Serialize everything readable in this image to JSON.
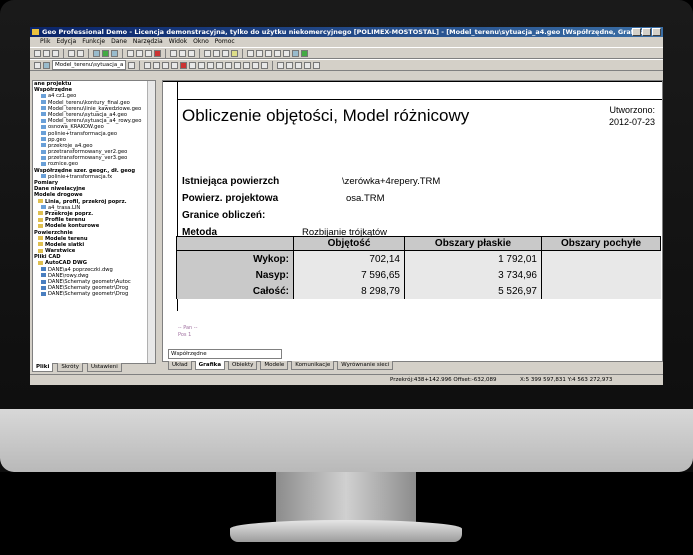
{
  "window": {
    "title": "Geo Professional Demo - Licencja demonstracyjna, tylko do użytku niekomercyjnego [POLIMEX-MOSTOSTAL] - [Model_terenu\\sytuacja_a4.geo [Współrzędne, Grafika]]"
  },
  "menu": [
    "Plik",
    "Edycja",
    "Funkcje",
    "Dane",
    "Narzędzia",
    "Widok",
    "Okno",
    "Pomoc"
  ],
  "toolbar": {
    "combo": "Model_terenu\\sytuacja_a"
  },
  "sidebar": {
    "items": [
      {
        "label": "ane projektu",
        "bold": true,
        "icon": ""
      },
      {
        "label": "Współrzędne",
        "bold": true,
        "icon": ""
      },
      {
        "label": "a4 cz1.geo",
        "bold": false,
        "icon": "geo"
      },
      {
        "label": "Model_terenu\\kontury_final.geo",
        "bold": false,
        "icon": "geo"
      },
      {
        "label": "Model_terenu\\linie_kawedziowe.geo",
        "bold": false,
        "icon": "geo"
      },
      {
        "label": "Model_terenu\\sytuacja_a4.geo",
        "bold": false,
        "icon": "geo"
      },
      {
        "label": "Model_terenu\\sytuacja_a4_rowy.geo",
        "bold": false,
        "icon": "geo"
      },
      {
        "label": "osnowa_KRAKOW.geo",
        "bold": false,
        "icon": "geo"
      },
      {
        "label": "polinie+transformacja.geo",
        "bold": false,
        "icon": "geo"
      },
      {
        "label": "pp.geo",
        "bold": false,
        "icon": "geo"
      },
      {
        "label": "przekroje_a4.geo",
        "bold": false,
        "icon": "geo"
      },
      {
        "label": "przetransformowany_ver2.geo",
        "bold": false,
        "icon": "geo"
      },
      {
        "label": "przetransformowany_ver3.geo",
        "bold": false,
        "icon": "geo"
      },
      {
        "label": "roznice.geo",
        "bold": false,
        "icon": "geo"
      },
      {
        "label": "Współrzędne szer. geogr., dł. geog",
        "bold": true,
        "icon": ""
      },
      {
        "label": "polinie+transformacja.fx",
        "bold": false,
        "icon": "geo"
      },
      {
        "label": "Pomiary",
        "bold": true,
        "icon": ""
      },
      {
        "label": "Dane niwelacyjne",
        "bold": true,
        "icon": ""
      },
      {
        "label": "Modele drogowe",
        "bold": true,
        "icon": ""
      },
      {
        "label": "Linia, profil, przekrój poprz.",
        "bold": true,
        "icon": "fold"
      },
      {
        "label": "a4_trasa.LIN",
        "bold": false,
        "icon": "geo"
      },
      {
        "label": "Przekroje poprz.",
        "bold": true,
        "icon": "fold"
      },
      {
        "label": "Profile terenu",
        "bold": true,
        "icon": "fold"
      },
      {
        "label": "Modele konturowe",
        "bold": true,
        "icon": "fold"
      },
      {
        "label": "Powierzchnie",
        "bold": true,
        "icon": ""
      },
      {
        "label": "Modele terenu",
        "bold": true,
        "icon": "fold"
      },
      {
        "label": "Modele siatki",
        "bold": true,
        "icon": "fold"
      },
      {
        "label": "Warstwice",
        "bold": true,
        "icon": "fold"
      },
      {
        "label": "Pliki CAD",
        "bold": true,
        "icon": ""
      },
      {
        "label": "AutoCAD DWG",
        "bold": true,
        "icon": "fold"
      },
      {
        "label": "DANE\\a4 poprzeczki.dwg",
        "bold": false,
        "icon": "dwg"
      },
      {
        "label": "DANE\\rowy.dwg",
        "bold": false,
        "icon": "dwg"
      },
      {
        "label": "DANE\\Schematy geometr\\Autoc",
        "bold": false,
        "icon": "dwg"
      },
      {
        "label": "DANE\\Schematy geometr\\Drog",
        "bold": false,
        "icon": "dwg"
      },
      {
        "label": "DANE\\Schematy geometr\\Drog",
        "bold": false,
        "icon": "dwg"
      }
    ],
    "tabs": [
      "Pliki",
      "Skróty",
      "Ustawieni"
    ]
  },
  "report": {
    "title": "Obliczenie objętości, Model różnicowy",
    "created_label": "Utworzono:",
    "created_date": "2012-07-23",
    "fields": [
      {
        "label": "Istniejąca powierzch",
        "value": "\\zerówka+4repery.TRM"
      },
      {
        "label": "Powierz. projektowa",
        "value": "osa.TRM"
      },
      {
        "label": "Granice obliczeń:",
        "value": ""
      },
      {
        "label": "Metoda",
        "value": "Rozbijanie trójkątów"
      }
    ],
    "table": {
      "headers": [
        "",
        "Objętość",
        "Obszary płaskie",
        "Obszary pochyłe"
      ],
      "rows": [
        {
          "label": "Wykop:",
          "volume": "702,14",
          "flat": "1 792,01",
          "slope": ""
        },
        {
          "label": "Nasyp:",
          "volume": "7 596,65",
          "flat": "3 734,96",
          "slope": ""
        },
        {
          "label": "Całość:",
          "volume": "8 298,79",
          "flat": "5 526,97",
          "slope": ""
        }
      ]
    }
  },
  "cmd": {
    "line1": "-- Pan --",
    "line2": "Pos 1"
  },
  "bottom": {
    "status_field": "Współrzędne",
    "tabs": [
      "Układ",
      "Grafika",
      "Obiekty",
      "Modele",
      "Komunikacje",
      "Wyrównanie sieci"
    ]
  },
  "status": {
    "coords": "Przekrój:438+142.996 Offset:-632,089",
    "xy": "X:5 399 597,831  Y:4 563 272,973"
  }
}
